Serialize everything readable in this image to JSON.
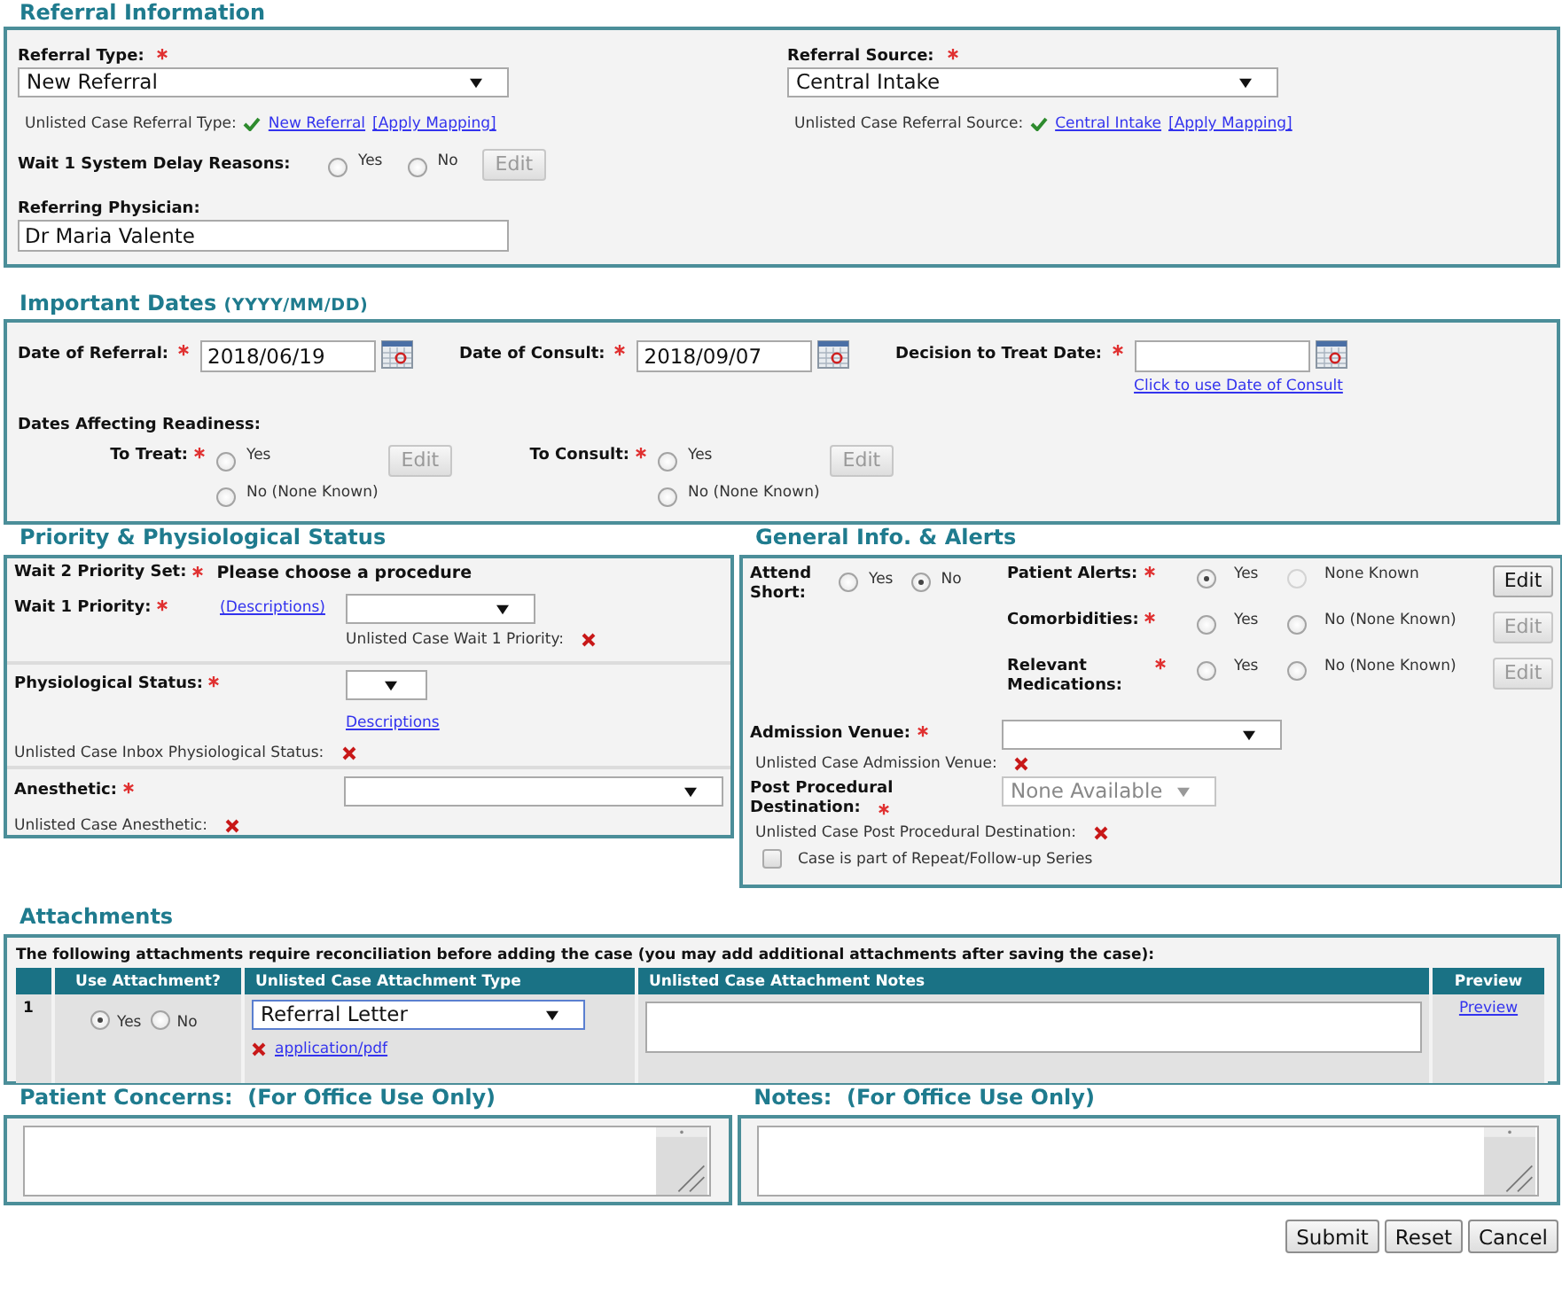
{
  "referral_information": {
    "title": "Referral Information",
    "fields": [
      {
        "label": "Referral Type:",
        "required": true,
        "value": "New Referral",
        "unlisted_label": "Unlisted Case Referral Type:",
        "mapped": true,
        "link": "New Referral",
        "apply": "[Apply Mapping]"
      },
      {
        "label": "Referral Source:",
        "required": true,
        "value": "Central Intake",
        "unlisted_label": "Unlisted Case Referral Source:",
        "mapped": true,
        "link": "Central Intake",
        "apply": "[Apply Mapping]"
      }
    ],
    "delay_reasons": {
      "label": "Wait 1 System Delay Reasons:",
      "options": [
        {
          "label": "Yes",
          "selected": false
        },
        {
          "label": "No",
          "selected": false
        }
      ],
      "edit": "Edit",
      "edit_disabled": true
    },
    "referring_physician": {
      "label": "Referring Physician:",
      "value": "Dr Maria Valente"
    }
  },
  "important_dates": {
    "title": "Important Dates",
    "format": "(YYYY/MM/DD)",
    "dates": [
      {
        "label": "Date of Referral:",
        "required": true,
        "value": "2018/06/19"
      },
      {
        "label": "Date of Consult:",
        "required": true,
        "value": "2018/09/07"
      },
      {
        "label": "Decision to Treat Date:",
        "required": true,
        "link": "Click to use Date of Consult"
      }
    ],
    "readiness_label": "Dates Affecting Readiness:",
    "readiness": [
      {
        "label": "To Treat:",
        "required": true,
        "options": [
          {
            "label": "Yes",
            "selected": false
          },
          {
            "label": "No (None Known)",
            "selected": false
          }
        ],
        "edit": "Edit",
        "edit_disabled": true
      },
      {
        "label": "To Consult:",
        "required": true,
        "options": [
          {
            "label": "Yes",
            "selected": false
          },
          {
            "label": "No (None Known)",
            "selected": false
          }
        ],
        "edit": "Edit",
        "edit_disabled": true
      }
    ]
  },
  "priority": {
    "title": "Priority & Physiological Status",
    "wait2": {
      "label": "Wait 2 Priority Set:",
      "required": true,
      "value": "Please choose a procedure"
    },
    "wait1": {
      "label": "Wait 1 Priority:",
      "required": true,
      "link": "(Descriptions)",
      "unlisted_label": "Unlisted Case Wait 1 Priority:",
      "mapped": false
    },
    "physiological": {
      "label": "Physiological Status:",
      "required": true,
      "link": "Descriptions",
      "unlisted_label": "Unlisted Case Inbox Physiological Status:",
      "mapped": false
    },
    "anesthetic": {
      "label": "Anesthetic:",
      "required": true,
      "unlisted_label": "Unlisted Case Anesthetic:",
      "mapped": false
    }
  },
  "general": {
    "title": "General Info. & Alerts",
    "attend_short": {
      "label": "Attend Short:",
      "options": [
        {
          "label": "Yes",
          "selected": false
        },
        {
          "label": "No",
          "selected": true
        }
      ]
    },
    "alerts": [
      {
        "label": "Patient Alerts:",
        "required": true,
        "options": [
          {
            "label": "Yes",
            "selected": true,
            "disabled": false
          },
          {
            "label": "None Known",
            "selected": false,
            "disabled": true
          }
        ],
        "edit": "Edit",
        "edit_disabled": false
      },
      {
        "label": "Comorbidities:",
        "required": true,
        "options": [
          {
            "label": "Yes",
            "selected": false,
            "disabled": false
          },
          {
            "label": "No (None Known)",
            "selected": false,
            "disabled": false
          }
        ],
        "edit": "Edit",
        "edit_disabled": true
      },
      {
        "label": "Relevant Medications:",
        "required": true,
        "options": [
          {
            "label": "Yes",
            "selected": false,
            "disabled": false
          },
          {
            "label": "No (None Known)",
            "selected": false,
            "disabled": false
          }
        ],
        "edit": "Edit",
        "edit_disabled": true
      }
    ],
    "admission_venue": {
      "label": "Admission Venue:",
      "required": true,
      "unlisted_label": "Unlisted Case Admission Venue:",
      "mapped": false
    },
    "post_procedural": {
      "label": "Post Procedural Destination:",
      "required": true,
      "value": "None Available",
      "disabled": true,
      "unlisted_label": "Unlisted Case Post Procedural Destination:",
      "mapped": false
    },
    "repeat_series": {
      "label": "Case is part of Repeat/Follow-up Series",
      "checked": false
    }
  },
  "attachments": {
    "title": "Attachments",
    "intro": "The following attachments require reconciliation before adding the case (you may add additional attachments after saving the case):",
    "columns": [
      "Use Attachment?",
      "Unlisted Case Attachment Type",
      "Unlisted Case Attachment Notes",
      "Preview"
    ],
    "rows": [
      {
        "index": "1",
        "use": [
          {
            "label": "Yes",
            "selected": true
          },
          {
            "label": "No",
            "selected": false
          }
        ],
        "type": "Referral Letter",
        "mapped": false,
        "mime": "application/pdf",
        "preview": "Preview"
      }
    ]
  },
  "notes": [
    {
      "title": "Patient Concerns:",
      "note": "(For Office Use Only)"
    },
    {
      "title": "Notes:",
      "note": "(For Office Use Only)"
    }
  ],
  "buttons": [
    "Submit",
    "Reset",
    "Cancel"
  ]
}
